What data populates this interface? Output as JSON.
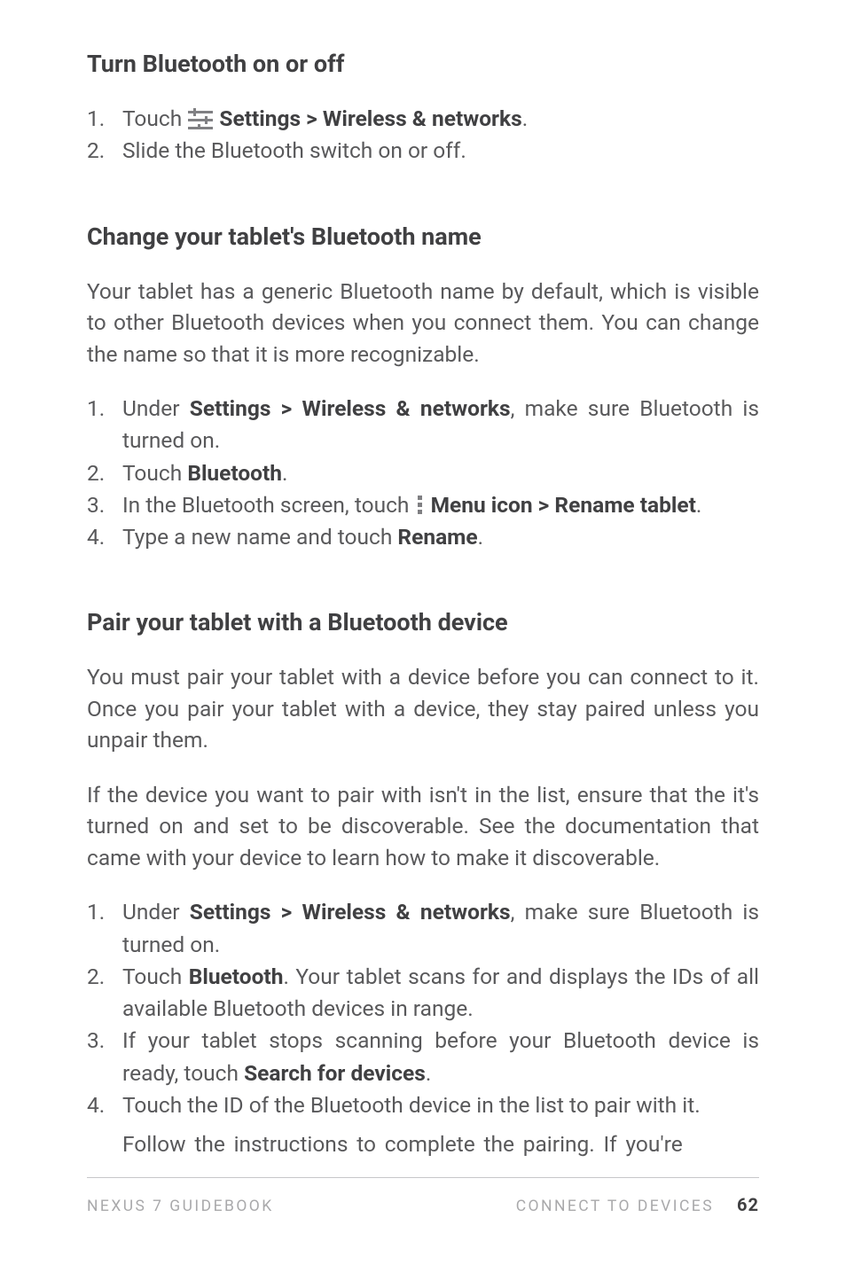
{
  "section1": {
    "heading": "Turn Bluetooth on or off",
    "steps": {
      "s1_pre": "Touch ",
      "s1_bold": "Settings > Wireless & networks",
      "s1_post": ".",
      "s2": "Slide the Bluetooth switch on or off."
    }
  },
  "section2": {
    "heading": "Change your tablet's Bluetooth name",
    "intro": "Your tablet has a generic Bluetooth name by default, which is vis­ible to other Bluetooth devices when you connect them. You can change the name so that it is more recognizable.",
    "steps": {
      "s1_pre": "Under ",
      "s1_bold": "Settings > Wireless & networks",
      "s1_post": ", make sure Bluetooth is turned on.",
      "s2_pre": "Touch ",
      "s2_bold": "Bluetooth",
      "s2_post": ".",
      "s3_pre": "In the Bluetooth screen, touch ",
      "s3_bold": " Menu icon > Rename tablet",
      "s3_post": ".",
      "s4_pre": "Type a new name and touch ",
      "s4_bold": "Rename",
      "s4_post": "."
    }
  },
  "section3": {
    "heading": "Pair your tablet with a Bluetooth device",
    "intro1": "You must pair your tablet with a device before you can connect to it. Once you pair your tablet with a device, they stay paired unless you unpair them.",
    "intro2": "If the device you want to pair with isn't in the list, ensure that the it's turned on and set to be discoverable. See the documentation that came with your device to learn how to make it discoverable.",
    "steps": {
      "s1_pre": "Under ",
      "s1_bold": "Settings > Wireless & networks",
      "s1_post": ", make sure Bluetooth is turned on.",
      "s2_pre": "Touch ",
      "s2_bold": "Bluetooth",
      "s2_post": ". Your tablet scans for and displays the IDs of all available Bluetooth devices in range.",
      "s3_pre": "If your tablet stops scanning before your Bluetooth device is ready, touch ",
      "s3_bold": "Search for devices",
      "s3_post": ".",
      "s4": "Touch the ID of the Bluetooth device in the list to pair with it.",
      "s4_follow": "Follow the instructions to complete the pairing. If you're"
    }
  },
  "footer": {
    "left": "NEXUS 7 GUIDEBOOK",
    "right": "CONNECT TO DEVICES",
    "page": "62"
  },
  "icons": {
    "settings": "settings-sliders-icon",
    "menu": "overflow-menu-icon"
  }
}
